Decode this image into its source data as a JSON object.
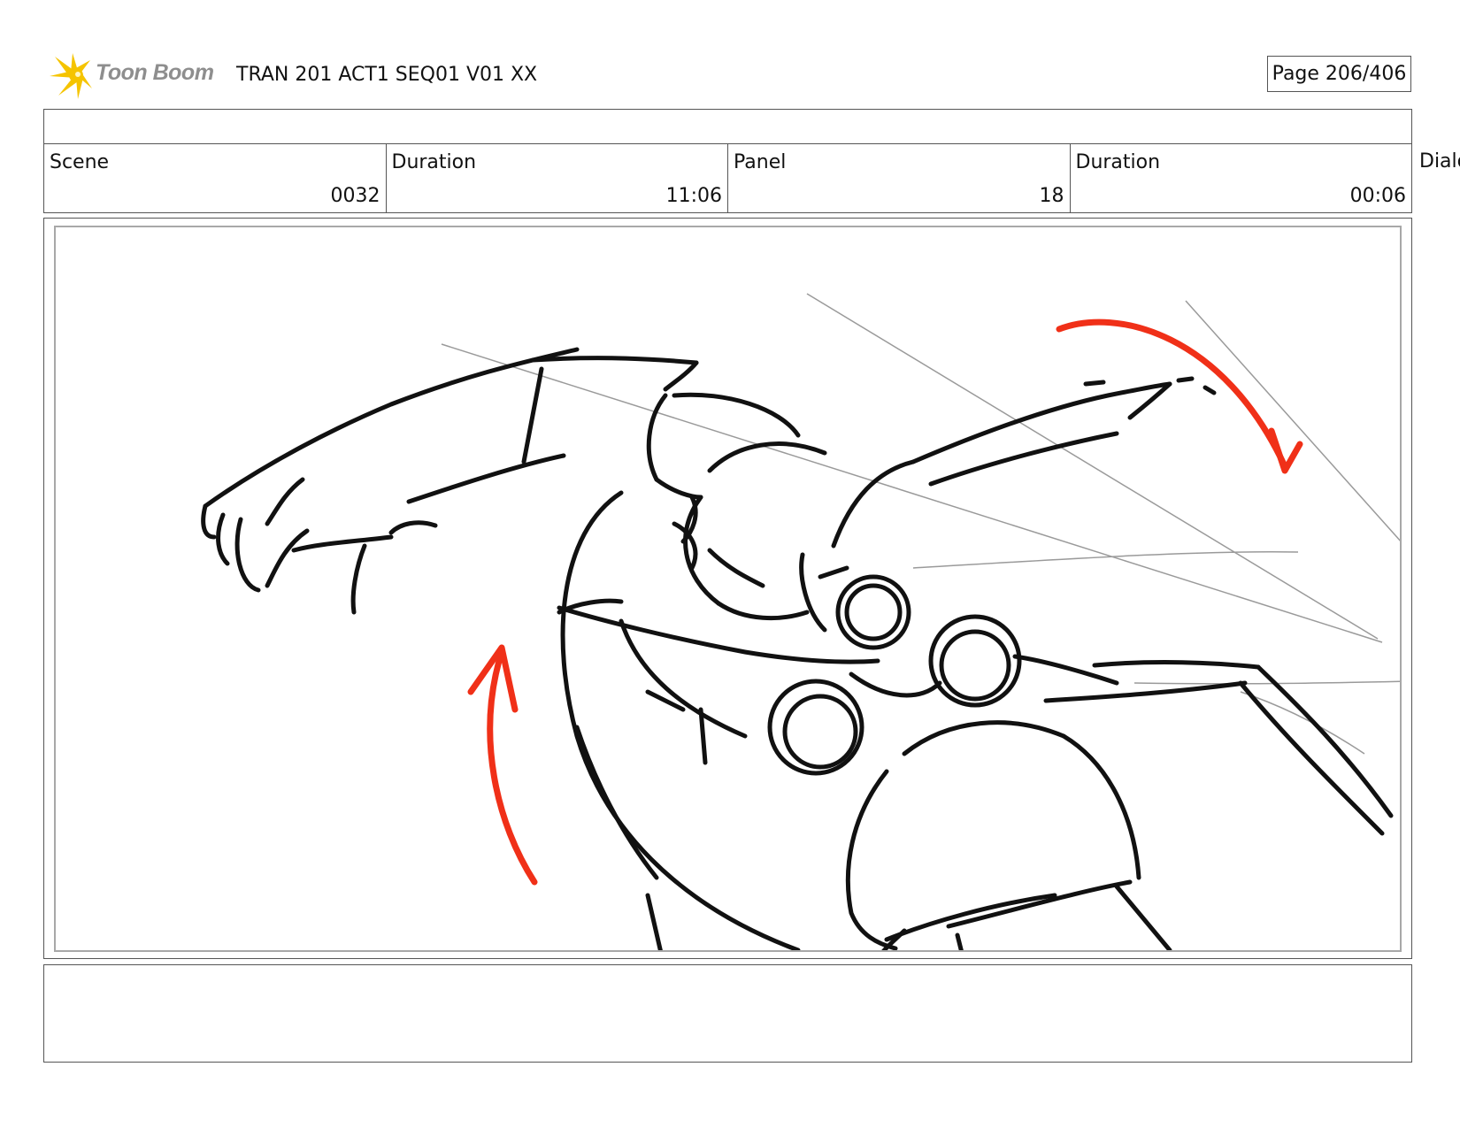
{
  "header": {
    "logo_text": "Toon Boom",
    "doc_title": "TRAN 201 ACT1 SEQ01 V01 XX",
    "page_indicator": "Page 206/406"
  },
  "info": {
    "scene_label": "Scene",
    "scene_value": "0032",
    "scene_duration_label": "Duration",
    "scene_duration_value": "11:06",
    "panel_label": "Panel",
    "panel_value": "18",
    "panel_duration_label": "Duration",
    "panel_duration_value": "00:06",
    "dialog_label": "Dialo"
  },
  "colors": {
    "logo_star": "#f5c400",
    "sketch_line": "#111111",
    "motion_arrow": "#f03018",
    "speed_line": "#9a9a9a",
    "border": "#555555"
  },
  "drawing": {
    "content": "rough storyboard sketch of two characters in a grapple with red motion arrows",
    "icons": [
      "starburst-logo-icon",
      "curved-arrow-icon"
    ]
  }
}
